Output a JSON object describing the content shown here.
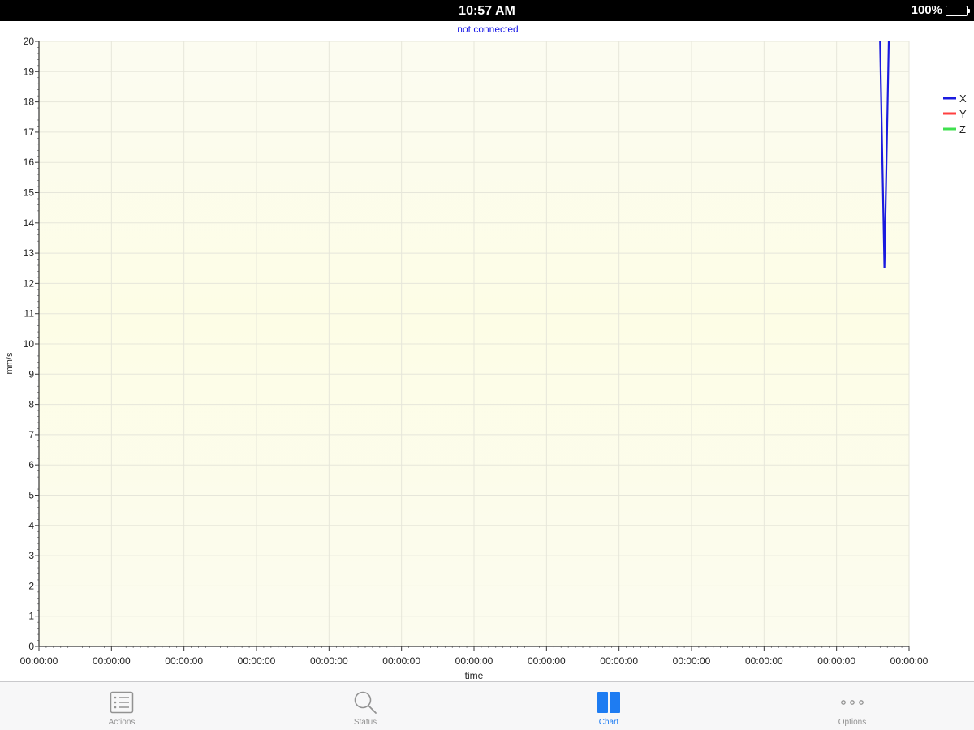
{
  "status_bar": {
    "time": "10:57 AM",
    "battery": "100%"
  },
  "connection_status": "not connected",
  "chart_data": {
    "type": "line",
    "title": "",
    "xlabel": "time",
    "ylabel": "mm/s",
    "ylim": [
      0,
      20
    ],
    "y_ticks": [
      0,
      1,
      2,
      3,
      4,
      5,
      6,
      7,
      8,
      9,
      10,
      11,
      12,
      13,
      14,
      15,
      16,
      17,
      18,
      19,
      20
    ],
    "x_tick_labels": [
      "00:00:00",
      "00:00:00",
      "00:00:00",
      "00:00:00",
      "00:00:00",
      "00:00:00",
      "00:00:00",
      "00:00:00",
      "00:00:00",
      "00:00:00",
      "00:00:00",
      "00:00:00",
      "00:00:00"
    ],
    "xlim": [
      0,
      12
    ],
    "grid": true,
    "legend_position": "right",
    "series": [
      {
        "name": "X",
        "color": "#1a1adf",
        "x": [
          11.6,
          11.66,
          11.72
        ],
        "y": [
          20,
          12.5,
          20
        ]
      },
      {
        "name": "Y",
        "color": "#ff4040",
        "x": [],
        "y": []
      },
      {
        "name": "Z",
        "color": "#3fe04f",
        "x": [],
        "y": []
      }
    ]
  },
  "tab_bar": {
    "tabs": [
      {
        "label": "Actions",
        "icon": "list-icon",
        "active": false
      },
      {
        "label": "Status",
        "icon": "search-icon",
        "active": false
      },
      {
        "label": "Chart",
        "icon": "book-icon",
        "active": true
      },
      {
        "label": "Options",
        "icon": "more-dots-icon",
        "active": false
      }
    ]
  }
}
